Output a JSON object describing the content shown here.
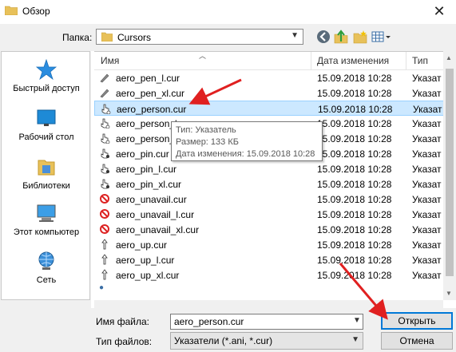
{
  "window": {
    "title": "Обзор",
    "close_glyph": "✕"
  },
  "pathbar": {
    "label": "Папка:",
    "current": "Cursors"
  },
  "places": [
    {
      "label": "Быстрый доступ",
      "icon": "quick-access-star-icon"
    },
    {
      "label": "Рабочий стол",
      "icon": "desktop-icon"
    },
    {
      "label": "Библиотеки",
      "icon": "libraries-icon"
    },
    {
      "label": "Этот компьютер",
      "icon": "this-pc-icon"
    },
    {
      "label": "Сеть",
      "icon": "network-icon"
    }
  ],
  "columns": {
    "name": "Имя",
    "date": "Дата изменения",
    "type": "Тип"
  },
  "files": [
    {
      "name": "aero_pen_l.cur",
      "date": "15.09.2018 10:28",
      "type": "Указат",
      "icon": "pen-cursor-icon"
    },
    {
      "name": "aero_pen_xl.cur",
      "date": "15.09.2018 10:28",
      "type": "Указат",
      "icon": "pen-cursor-icon"
    },
    {
      "name": "aero_person.cur",
      "date": "15.09.2018 10:28",
      "type": "Указат",
      "icon": "person-cursor-icon",
      "selected": true
    },
    {
      "name": "aero_person_l",
      "date": "15.09.2018 10:28",
      "type": "Указат",
      "icon": "person-cursor-icon"
    },
    {
      "name": "aero_person_x",
      "date": "15.09.2018 10:28",
      "type": "Указат",
      "icon": "person-cursor-icon"
    },
    {
      "name": "aero_pin.cur",
      "date": "15.09.2018 10:28",
      "type": "Указат",
      "icon": "pin-cursor-icon"
    },
    {
      "name": "aero_pin_l.cur",
      "date": "15.09.2018 10:28",
      "type": "Указат",
      "icon": "pin-cursor-icon"
    },
    {
      "name": "aero_pin_xl.cur",
      "date": "15.09.2018 10:28",
      "type": "Указат",
      "icon": "pin-cursor-icon"
    },
    {
      "name": "aero_unavail.cur",
      "date": "15.09.2018 10:28",
      "type": "Указат",
      "icon": "unavailable-cursor-icon"
    },
    {
      "name": "aero_unavail_l.cur",
      "date": "15.09.2018 10:28",
      "type": "Указат",
      "icon": "unavailable-cursor-icon"
    },
    {
      "name": "aero_unavail_xl.cur",
      "date": "15.09.2018 10:28",
      "type": "Указат",
      "icon": "unavailable-cursor-icon"
    },
    {
      "name": "aero_up.cur",
      "date": "15.09.2018 10:28",
      "type": "Указат",
      "icon": "up-arrow-cursor-icon"
    },
    {
      "name": "aero_up_l.cur",
      "date": "15.09.2018 10:28",
      "type": "Указат",
      "icon": "up-arrow-cursor-icon"
    },
    {
      "name": "aero_up_xl.cur",
      "date": "15.09.2018 10:28",
      "type": "Указат",
      "icon": "up-arrow-cursor-icon"
    }
  ],
  "tooltip": {
    "type_line": "Тип: Указатель",
    "size_line": "Размер: 133 КБ",
    "date_line": "Дата изменения: 15.09.2018 10:28"
  },
  "bottom": {
    "filename_label": "Имя файла:",
    "filename_value": "aero_person.cur",
    "filetype_label": "Тип файлов:",
    "filetype_value": "Указатели (*.ani, *.cur)",
    "open_label": "Открыть",
    "cancel_label": "Отмена"
  },
  "colors": {
    "selection": "#cce8ff",
    "accent": "#0078d7",
    "annotation_arrow": "#e02020"
  }
}
